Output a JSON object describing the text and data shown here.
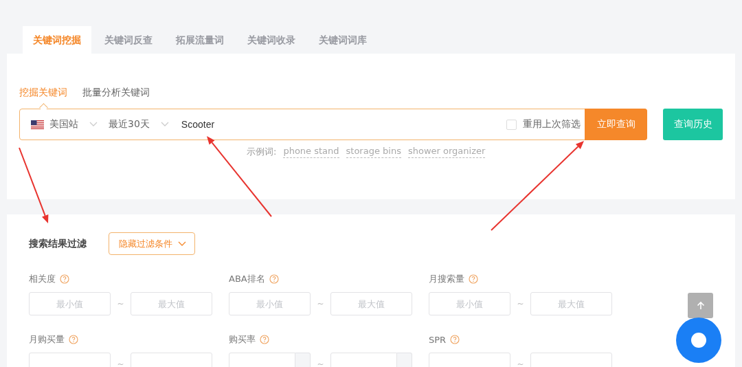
{
  "tabs": [
    {
      "label": "关键词挖掘",
      "selected": true
    },
    {
      "label": "关键词反查",
      "selected": false
    },
    {
      "label": "拓展流量词",
      "selected": false
    },
    {
      "label": "关键词收录",
      "selected": false
    },
    {
      "label": "关键词词库",
      "selected": false
    }
  ],
  "subtabs": [
    {
      "label": "挖掘关键词",
      "selected": true
    },
    {
      "label": "批量分析关键词",
      "selected": false
    }
  ],
  "search": {
    "site": "美国站",
    "period": "最近30天",
    "value": "Scooter",
    "reuse_label": "重用上次筛选",
    "reuse_checked": false,
    "submit": "立即查询",
    "history": "查询历史"
  },
  "examples": {
    "label": "示例词:",
    "words": [
      "phone stand",
      "storage bins",
      "shower organizer"
    ]
  },
  "filter": {
    "title": "搜索结果过滤",
    "toggle": "隐藏过滤条件",
    "fields": [
      {
        "label": "相关度",
        "min_placeholder": "最小值",
        "separator": "~",
        "max_placeholder": "最大值",
        "has_unit": false
      },
      {
        "label": "ABA排名",
        "min_placeholder": "最小值",
        "separator": "~",
        "max_placeholder": "最大值",
        "has_unit": false
      },
      {
        "label": "月搜索量",
        "min_placeholder": "最小值",
        "separator": "~",
        "max_placeholder": "最大值",
        "has_unit": false
      },
      {
        "label": "月购买量",
        "separator": "~",
        "has_unit": false
      },
      {
        "label": "购买率",
        "separator": "~",
        "has_unit": true
      },
      {
        "label": "SPR",
        "separator": "~",
        "has_unit": false
      }
    ]
  }
}
